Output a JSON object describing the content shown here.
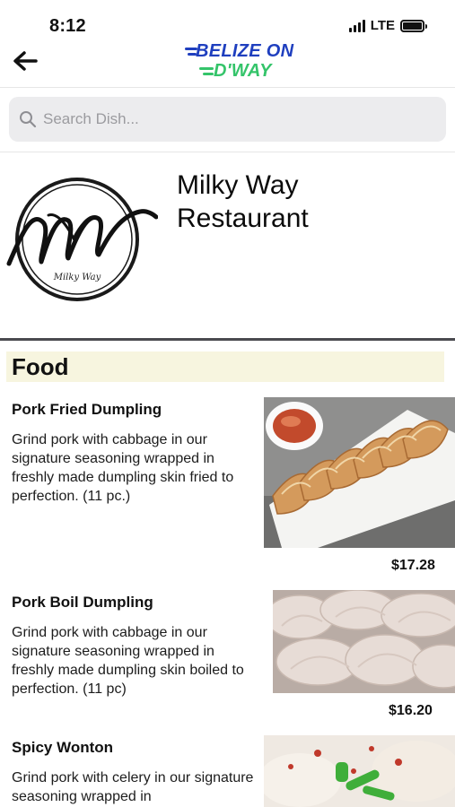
{
  "status": {
    "time": "8:12",
    "network": "LTE"
  },
  "brand": {
    "line1": "BELIZE ON",
    "line2": "D'WAY",
    "primary_color": "#1f3fbf",
    "accent_color": "#34c46a"
  },
  "search": {
    "placeholder": "Search Dish..."
  },
  "restaurant": {
    "name": "Milky Way Restaurant",
    "logo_text": "Milky Way"
  },
  "menu": {
    "section_title": "Food",
    "section_bg": "#f7f5df",
    "dishes": [
      {
        "name": "Pork Fried Dumpling",
        "description": "Grind pork with cabbage in our signature seasoning wrapped in freshly made dumpling skin fried to perfection. (11 pc.)",
        "price": "$17.28"
      },
      {
        "name": "Pork Boil Dumpling",
        "description": "Grind pork with cabbage in our signature seasoning wrapped in freshly made dumpling skin boiled to perfection. (11 pc)",
        "price": "$16.20"
      },
      {
        "name": "Spicy Wonton",
        "description": "Grind pork with celery in our signature seasoning wrapped in"
      }
    ]
  },
  "icons": {
    "back": "arrow-left-icon",
    "search": "search-icon"
  }
}
